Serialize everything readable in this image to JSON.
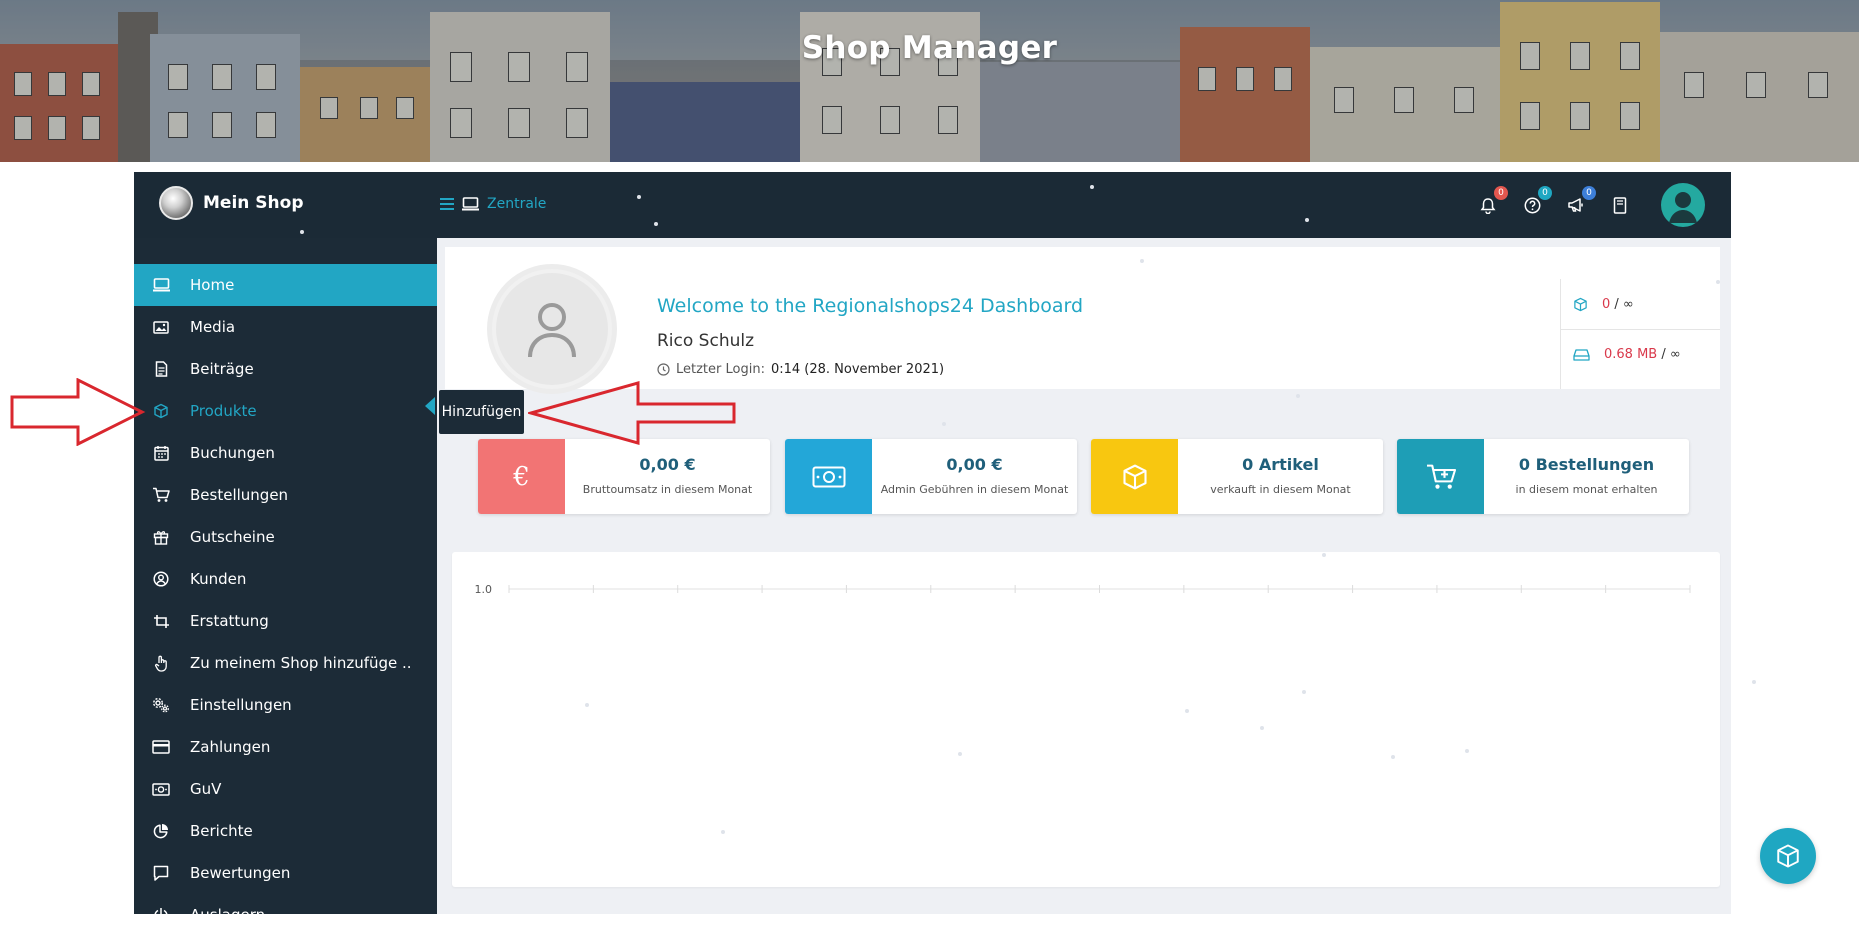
{
  "banner": {
    "title": "Shop Manager"
  },
  "topbar": {
    "brand_name": "Mein Shop",
    "breadcrumb": "Zentrale",
    "notifications_count": "0",
    "help_count": "0",
    "announcements_count": "0"
  },
  "sidebar": {
    "items": [
      {
        "label": "Home",
        "icon": "monitor-icon"
      },
      {
        "label": "Media",
        "icon": "image-icon"
      },
      {
        "label": "Beiträge",
        "icon": "document-icon"
      },
      {
        "label": "Produkte",
        "icon": "box-icon"
      },
      {
        "label": "Buchungen",
        "icon": "calendar-icon"
      },
      {
        "label": "Bestellungen",
        "icon": "cart-icon"
      },
      {
        "label": "Gutscheine",
        "icon": "gift-icon"
      },
      {
        "label": "Kunden",
        "icon": "user-circle-icon"
      },
      {
        "label": "Erstattung",
        "icon": "crop-icon"
      },
      {
        "label": "Zu meinem Shop hinzufüge ..",
        "icon": "hand-pointer-icon"
      },
      {
        "label": "Einstellungen",
        "icon": "gears-icon"
      },
      {
        "label": "Zahlungen",
        "icon": "credit-card-icon"
      },
      {
        "label": "GuV",
        "icon": "money-icon"
      },
      {
        "label": "Berichte",
        "icon": "pie-chart-icon"
      },
      {
        "label": "Bewertungen",
        "icon": "comment-icon"
      },
      {
        "label": "Auslagern",
        "icon": "power-icon"
      }
    ],
    "tooltip": "Hinzufügen"
  },
  "welcome": {
    "title": "Welcome to the Regionalshops24 Dashboard",
    "user_name": "Rico Schulz",
    "last_login_label": "Letzter Login:",
    "last_login_value": "0:14 (28. November 2021)",
    "products_used": "0",
    "products_limit": "/ ∞",
    "storage_used": "0.68 MB",
    "storage_limit": "/ ∞"
  },
  "stats": [
    {
      "value": "0,00 €",
      "label": "Bruttoumsatz in diesem Monat",
      "color": "#f27474",
      "icon": "euro-icon"
    },
    {
      "value": "0,00 €",
      "label": "Admin Gebühren in diesem Monat",
      "color": "#23a7d8",
      "icon": "banknote-icon"
    },
    {
      "value": "0 Artikel",
      "label": "verkauft in diesem Monat",
      "color": "#f8c710",
      "icon": "box-icon"
    },
    {
      "value": "0 Bestellungen",
      "label": "in diesem monat erhalten",
      "color": "#1e9eb6",
      "icon": "cart-plus-icon"
    }
  ],
  "chart_data": {
    "type": "line",
    "y_tick_labels": [
      "1.0"
    ]
  },
  "colors": {
    "accent": "#22a6c4",
    "sidebar": "#1c2b37",
    "annotation_arrow": "#d9272e"
  }
}
